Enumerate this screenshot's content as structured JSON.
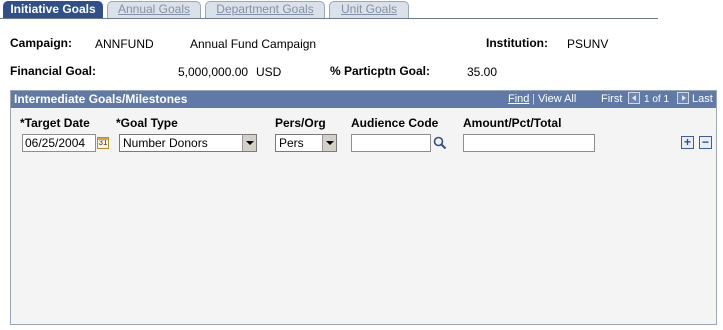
{
  "tabs": [
    {
      "label": "Initiative Goals",
      "active": true
    },
    {
      "label": "Annual Goals",
      "active": false
    },
    {
      "label": "Department Goals",
      "active": false
    },
    {
      "label": "Unit Goals",
      "active": false
    }
  ],
  "header": {
    "campaign_label": "Campaign:",
    "campaign_code": "ANNFUND",
    "campaign_name": "Annual Fund Campaign",
    "institution_label": "Institution:",
    "institution_value": "PSUNV",
    "financial_goal_label": "Financial Goal:",
    "financial_goal_value": "5,000,000.00",
    "financial_goal_currency": "USD",
    "particptn_goal_label": "% Particptn Goal:",
    "particptn_goal_value": "35.00"
  },
  "grid": {
    "title": "Intermediate Goals/Milestones",
    "find": "Find",
    "separator": "|",
    "view_all": "View All",
    "first": "First",
    "count": "1 of 1",
    "last": "Last",
    "columns": {
      "target_date": "*Target Date",
      "goal_type": "*Goal Type",
      "pers_org": "Pers/Org",
      "audience_code": "Audience Code",
      "amount": "Amount/Pct/Total"
    },
    "row": {
      "target_date": "06/25/2004",
      "goal_type": "Number Donors",
      "pers_org": "Pers",
      "audience_code": "",
      "amount": ""
    },
    "calendar_icon_text": "31",
    "add": "+",
    "remove": "−"
  },
  "colors": {
    "active_tab": "#2f5089",
    "grid_header": "#5f7aa6",
    "inactive_tab": "#dbe1ea"
  }
}
